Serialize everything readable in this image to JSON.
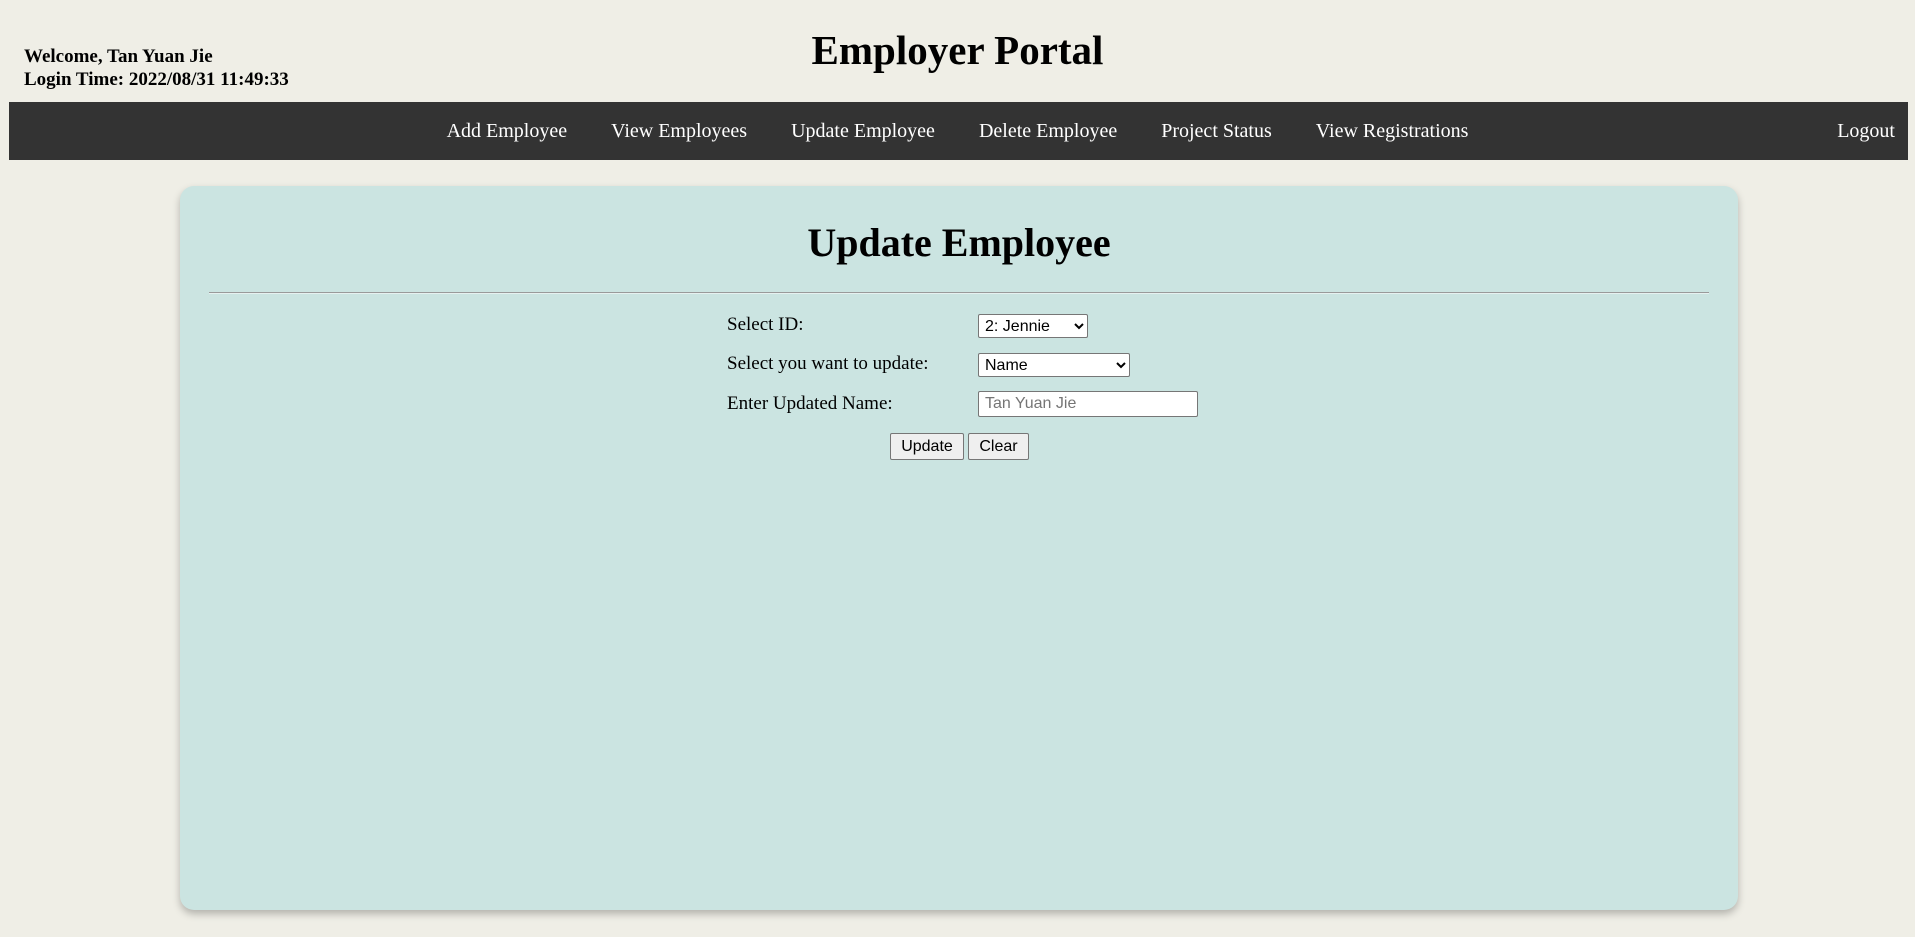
{
  "header": {
    "welcome": "Welcome, Tan Yuan Jie",
    "login_time": "Login Time: 2022/08/31 11:49:33",
    "title": "Employer Portal"
  },
  "nav": {
    "items": [
      {
        "label": "Add Employee"
      },
      {
        "label": "View Employees"
      },
      {
        "label": "Update Employee"
      },
      {
        "label": "Delete Employee"
      },
      {
        "label": "Project Status"
      },
      {
        "label": "View Registrations"
      }
    ],
    "logout": "Logout"
  },
  "main": {
    "title": "Update Employee",
    "form": {
      "select_id_label": "Select ID:",
      "select_id_value": "2: Jennie",
      "select_field_label": "Select you want to update:",
      "select_field_value": "Name",
      "name_label": "Enter Updated Name:",
      "name_placeholder": "Tan Yuan Jie",
      "name_value": "",
      "update_button": "Update",
      "clear_button": "Clear"
    }
  },
  "colors": {
    "page_bg": "#efeee6",
    "navbar_bg": "#333333",
    "nav_text": "#ffffff",
    "card_bg": "#cbe4e1"
  }
}
